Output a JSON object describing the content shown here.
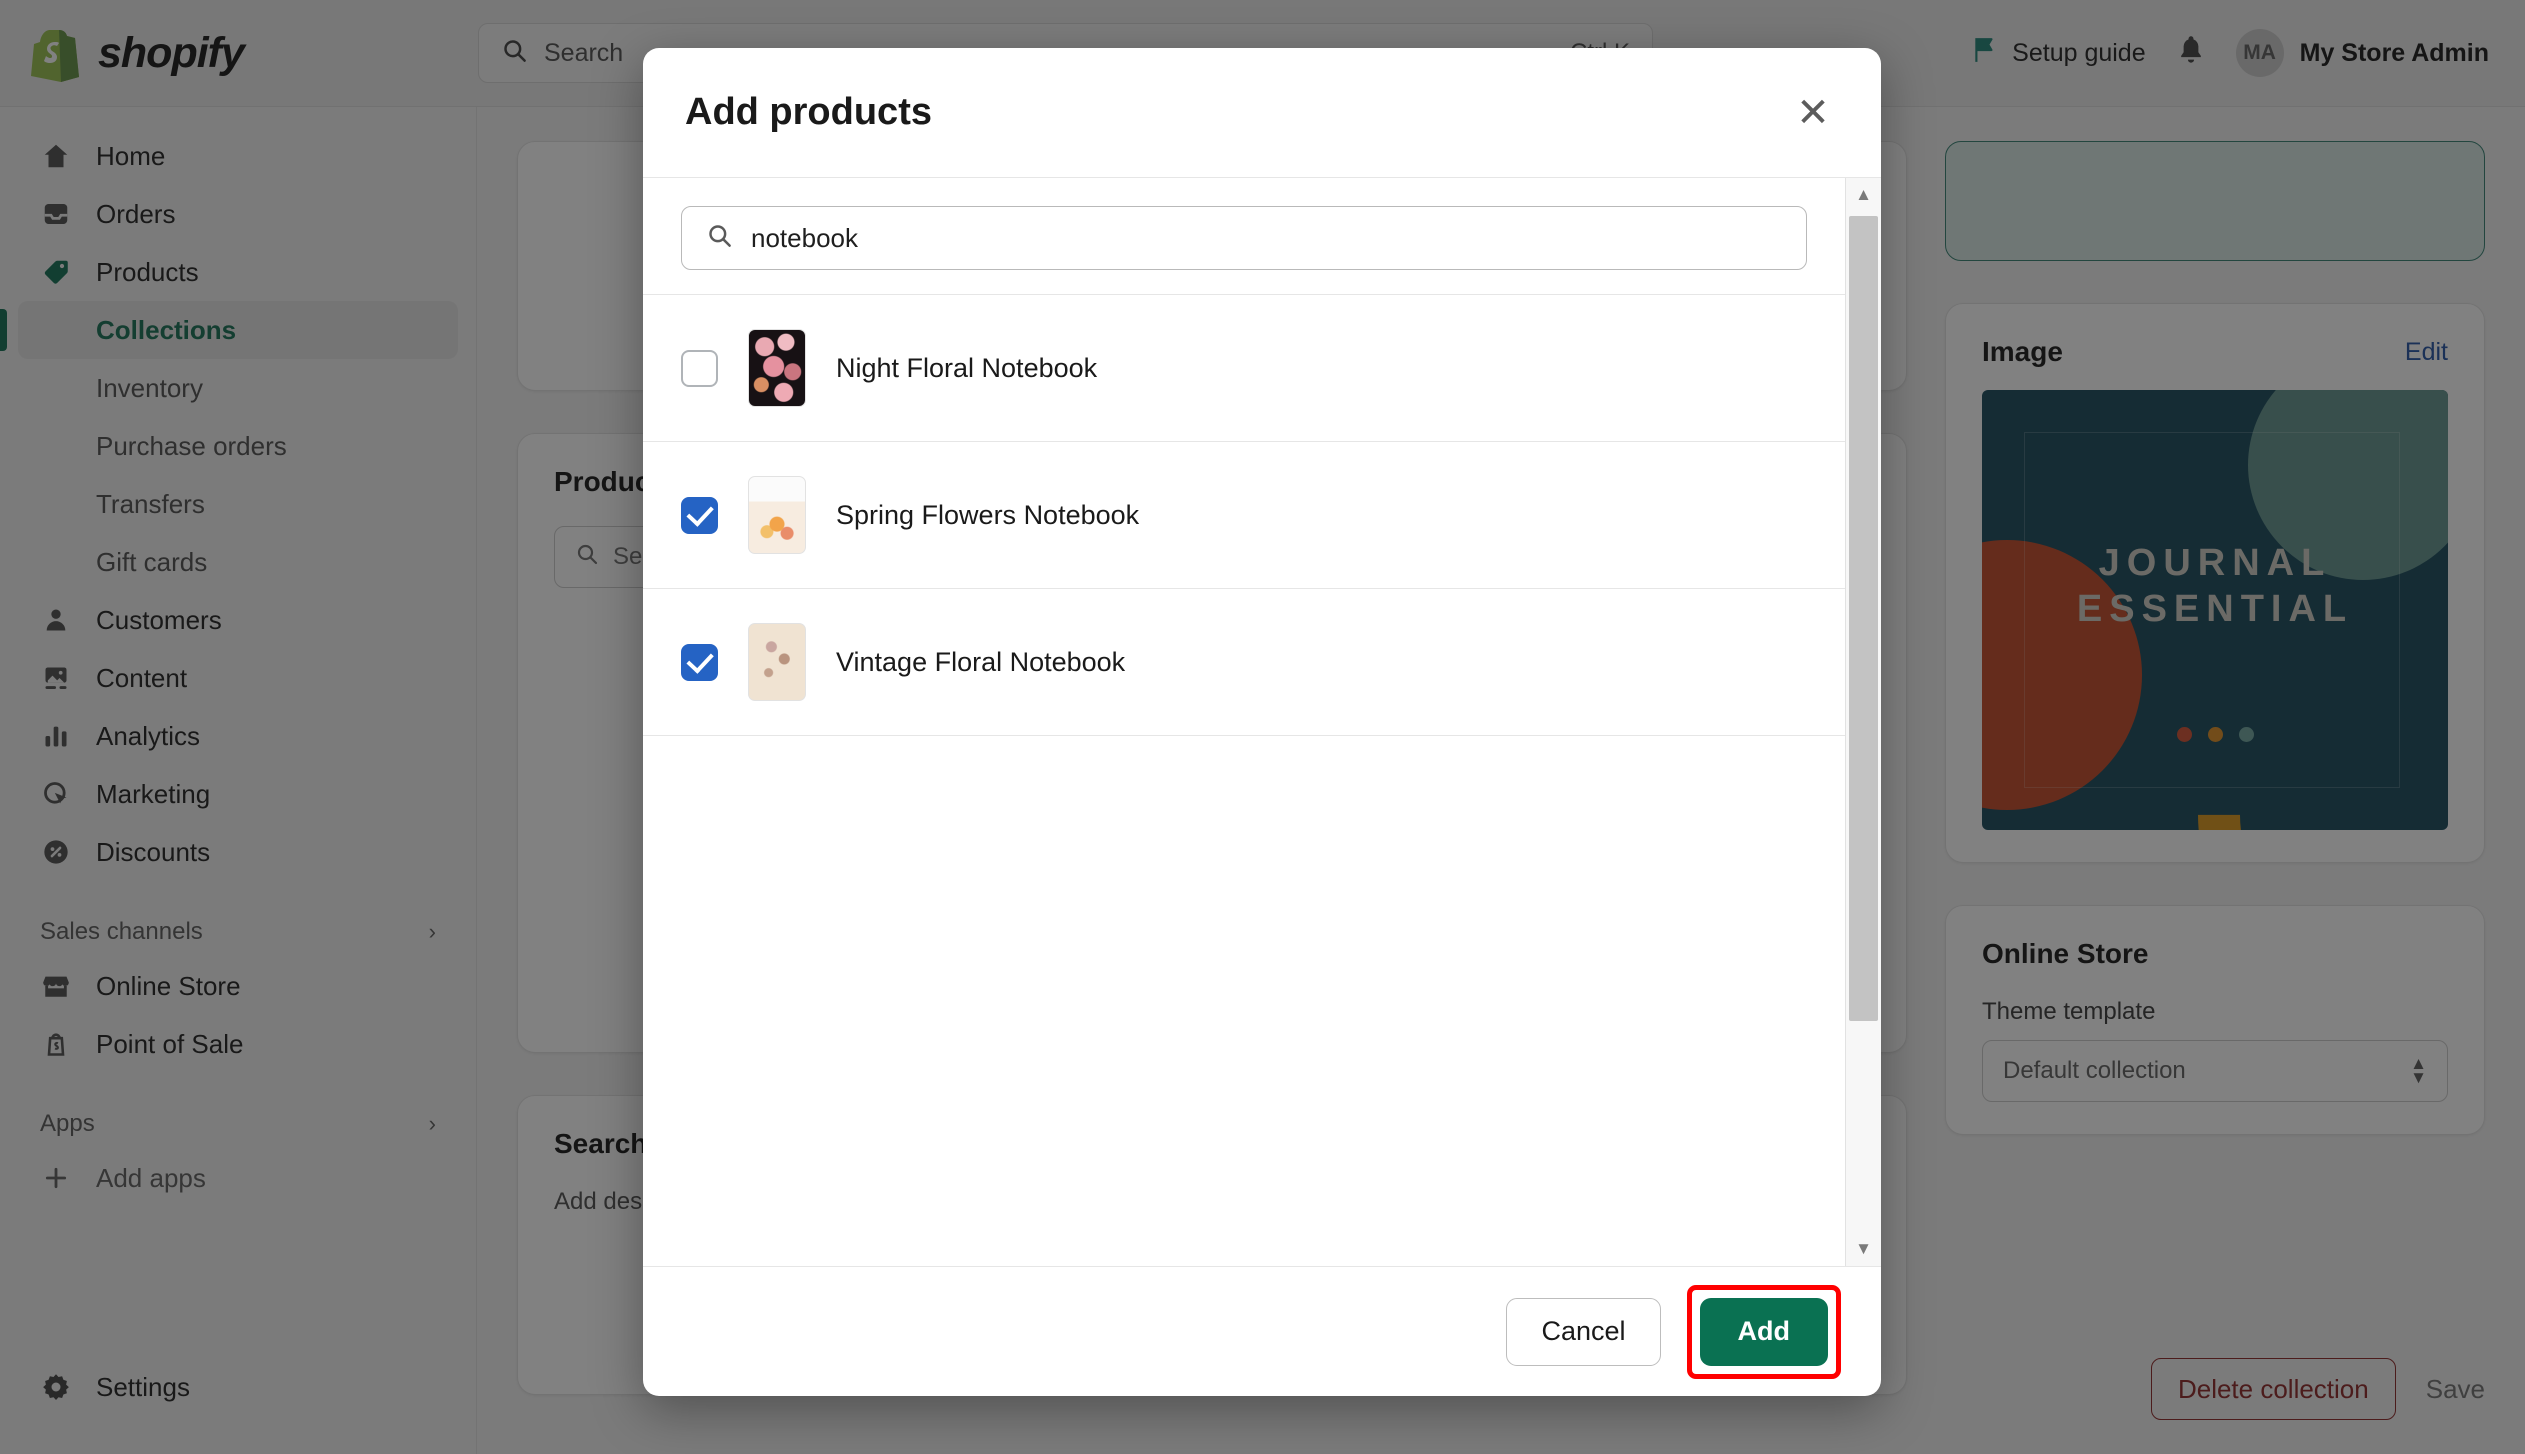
{
  "topbar": {
    "brand_name": "shopify",
    "search_placeholder": "Search",
    "search_shortcut": "Ctrl K",
    "setup_guide_label": "Setup guide",
    "avatar_initials": "MA",
    "admin_name": "My Store Admin"
  },
  "sidebar": {
    "items": [
      {
        "label": "Home",
        "icon": "home-icon"
      },
      {
        "label": "Orders",
        "icon": "orders-inbox-icon"
      },
      {
        "label": "Products",
        "icon": "product-tag-icon",
        "active": true
      }
    ],
    "product_subitems": [
      {
        "label": "Collections",
        "active": true
      },
      {
        "label": "Inventory",
        "active": false
      },
      {
        "label": "Purchase orders",
        "active": false
      },
      {
        "label": "Transfers",
        "active": false
      },
      {
        "label": "Gift cards",
        "active": false
      }
    ],
    "items2": [
      {
        "label": "Customers",
        "icon": "person-icon"
      },
      {
        "label": "Content",
        "icon": "image-content-icon"
      },
      {
        "label": "Analytics",
        "icon": "bar-chart-icon"
      },
      {
        "label": "Marketing",
        "icon": "target-cursor-icon"
      },
      {
        "label": "Discounts",
        "icon": "discount-percent-icon"
      }
    ],
    "sales_channels_label": "Sales channels",
    "channels": [
      {
        "label": "Online Store",
        "icon": "storefront-icon"
      },
      {
        "label": "Point of Sale",
        "icon": "pos-shopify-icon"
      }
    ],
    "apps_label": "Apps",
    "add_apps_label": "Add apps",
    "settings_label": "Settings"
  },
  "main": {
    "products_card": {
      "title": "Products",
      "search_placeholder": "Search products"
    },
    "seo_card": {
      "title": "Search engine listing",
      "add_label": "Add description"
    },
    "image_card": {
      "title": "Image",
      "edit_label": "Edit",
      "preview_title_line1": "JOURNAL",
      "preview_title_line2": "ESSENTIAL",
      "dot_colors": [
        "#d0492a",
        "#dd8b1c",
        "#6aa39c"
      ],
      "background_color": "#104456"
    },
    "online_store_card": {
      "title": "Online Store",
      "theme_label": "Theme template",
      "theme_value": "Default collection"
    },
    "footer": {
      "delete_label": "Delete collection",
      "save_label": "Save"
    }
  },
  "modal": {
    "title": "Add products",
    "close_icon": "close-icon",
    "search_value": "notebook",
    "search_icon": "search-icon",
    "products": [
      {
        "name": "Night Floral Notebook",
        "checked": false,
        "thumb": "t-night"
      },
      {
        "name": "Spring Flowers Notebook",
        "checked": true,
        "thumb": "t-spring"
      },
      {
        "name": "Vintage Floral Notebook",
        "checked": true,
        "thumb": "t-vintage"
      }
    ],
    "cancel_label": "Cancel",
    "add_label": "Add",
    "add_button_accent": "#0a7152",
    "highlight_color": "#ff0000"
  }
}
